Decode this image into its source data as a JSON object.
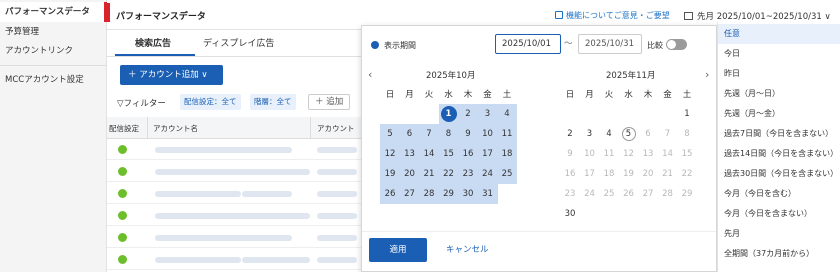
{
  "sidebar": {
    "items": [
      {
        "label": "パフォーマンスデータ",
        "active": true
      },
      {
        "label": "予算管理"
      },
      {
        "label": "アカウントリンク"
      },
      {
        "label": "MCCアカウント設定"
      }
    ]
  },
  "header": {
    "title": "パフォーマンスデータ",
    "feedback": "機能についてご意見・ご要望",
    "date_range": "先月 2025/10/01~2025/10/31"
  },
  "tabs": [
    {
      "label": "検索広告",
      "active": true
    },
    {
      "label": "ディスプレイ広告"
    }
  ],
  "toolbar": {
    "add_account": "＋ アカウント追加 ∨",
    "filter_label": "▽フィルター",
    "chips": [
      "配信設定：全て",
      "階層：全て"
    ],
    "add_filter": "＋ 追加"
  },
  "table": {
    "headers": [
      "配信設定",
      "アカウント名",
      "アカウント"
    ]
  },
  "picker": {
    "period_label": "表示期間",
    "start_value": "2025/10/01",
    "end_value": "2025/10/31",
    "tilde": "〜",
    "compare_label": "比較",
    "prev": "‹",
    "next": "›",
    "weekdays": [
      "日",
      "月",
      "火",
      "水",
      "木",
      "金",
      "土"
    ],
    "months": [
      {
        "title": "2025年10月",
        "rows": [
          [
            "",
            "",
            "",
            "1",
            "2",
            "3",
            "4"
          ],
          [
            "5",
            "6",
            "7",
            "8",
            "9",
            "10",
            "11"
          ],
          [
            "12",
            "13",
            "14",
            "15",
            "16",
            "17",
            "18"
          ],
          [
            "19",
            "20",
            "21",
            "22",
            "23",
            "24",
            "25"
          ],
          [
            "26",
            "27",
            "28",
            "29",
            "30",
            "31",
            ""
          ]
        ]
      },
      {
        "title": "2025年11月",
        "rows": [
          [
            "",
            "",
            "",
            "",
            "",
            "",
            "1"
          ],
          [
            "2",
            "3",
            "4",
            "5",
            "6",
            "7",
            "8"
          ],
          [
            "9",
            "10",
            "11",
            "12",
            "13",
            "14",
            "15"
          ],
          [
            "16",
            "17",
            "18",
            "19",
            "20",
            "21",
            "22"
          ],
          [
            "23",
            "24",
            "25",
            "26",
            "27",
            "28",
            "29"
          ],
          [
            "30",
            "",
            "",
            "",
            "",
            "",
            ""
          ]
        ]
      }
    ],
    "apply": "適用",
    "cancel": "キャンセル"
  },
  "presets": [
    {
      "label": "任意",
      "active": true
    },
    {
      "label": "今日"
    },
    {
      "label": "昨日"
    },
    {
      "label": "先週（月〜日）"
    },
    {
      "label": "先週（月〜金）"
    },
    {
      "label": "過去7日間（今日を含まない）"
    },
    {
      "label": "過去14日間（今日を含まない）"
    },
    {
      "label": "過去30日間（今日を含まない）"
    },
    {
      "label": "今月（今日を含む）"
    },
    {
      "label": "今月（今日を含まない）"
    },
    {
      "label": "先月"
    },
    {
      "label": "全期間（37カ月前から）"
    }
  ]
}
